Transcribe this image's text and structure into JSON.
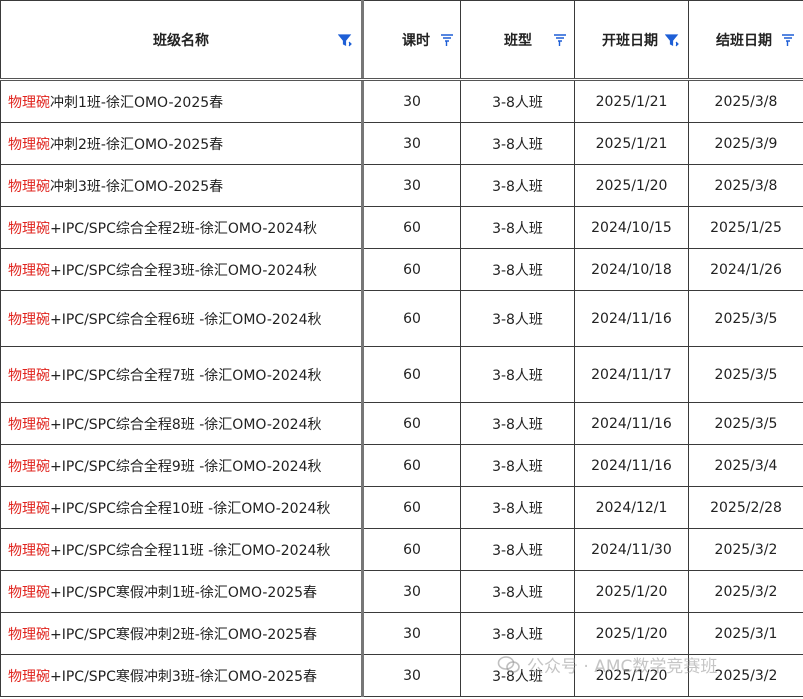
{
  "columns": [
    {
      "label": "班级名称",
      "filter": "active"
    },
    {
      "label": "课时",
      "filter": "inactive"
    },
    {
      "label": "班型",
      "filter": "inactive"
    },
    {
      "label": "开班日期",
      "filter": "active"
    },
    {
      "label": "结班日期",
      "filter": "inactive"
    }
  ],
  "rows": [
    {
      "brand": "物理碗",
      "rest": "冲刺1班-徐汇OMO-2025春",
      "hours": "30",
      "type": "3-8人班",
      "start": "2025/1/21",
      "end": "2025/3/8"
    },
    {
      "brand": "物理碗",
      "rest": "冲刺2班-徐汇OMO-2025春",
      "hours": "30",
      "type": "3-8人班",
      "start": "2025/1/21",
      "end": "2025/3/9"
    },
    {
      "brand": "物理碗",
      "rest": "冲刺3班-徐汇OMO-2025春",
      "hours": "30",
      "type": "3-8人班",
      "start": "2025/1/20",
      "end": "2025/3/8"
    },
    {
      "brand": "物理碗",
      "rest": "+IPC/SPC综合全程2班-徐汇OMO-2024秋",
      "hours": "60",
      "type": "3-8人班",
      "start": "2024/10/15",
      "end": "2025/1/25"
    },
    {
      "brand": "物理碗",
      "rest": "+IPC/SPC综合全程3班-徐汇OMO-2024秋",
      "hours": "60",
      "type": "3-8人班",
      "start": "2024/10/18",
      "end": "2024/1/26"
    },
    {
      "brand": "物理碗",
      "rest": "+IPC/SPC综合全程6班 -徐汇OMO-2024秋",
      "hours": "60",
      "type": "3-8人班",
      "start": "2024/11/16",
      "end": "2025/3/5"
    },
    {
      "brand": "物理碗",
      "rest": "+IPC/SPC综合全程7班 -徐汇OMO-2024秋",
      "hours": "60",
      "type": "3-8人班",
      "start": "2024/11/17",
      "end": "2025/3/5"
    },
    {
      "brand": "物理碗",
      "rest": "+IPC/SPC综合全程8班 -徐汇OMO-2024秋",
      "hours": "60",
      "type": "3-8人班",
      "start": "2024/11/16",
      "end": "2025/3/5"
    },
    {
      "brand": "物理碗",
      "rest": "+IPC/SPC综合全程9班 -徐汇OMO-2024秋",
      "hours": "60",
      "type": "3-8人班",
      "start": "2024/11/16",
      "end": "2025/3/4"
    },
    {
      "brand": "物理碗",
      "rest": "+IPC/SPC综合全程10班 -徐汇OMO-2024秋",
      "hours": "60",
      "type": "3-8人班",
      "start": "2024/12/1",
      "end": "2025/2/28"
    },
    {
      "brand": "物理碗",
      "rest": "+IPC/SPC综合全程11班 -徐汇OMO-2024秋",
      "hours": "60",
      "type": "3-8人班",
      "start": "2024/11/30",
      "end": "2025/3/2"
    },
    {
      "brand": "物理碗",
      "rest": "+IPC/SPC寒假冲刺1班-徐汇OMO-2025春",
      "hours": "30",
      "type": "3-8人班",
      "start": "2025/1/20",
      "end": "2025/3/2"
    },
    {
      "brand": "物理碗",
      "rest": "+IPC/SPC寒假冲刺2班-徐汇OMO-2025春",
      "hours": "30",
      "type": "3-8人班",
      "start": "2025/1/20",
      "end": "2025/3/1"
    },
    {
      "brand": "物理碗",
      "rest": "+IPC/SPC寒假冲刺3班-徐汇OMO-2025春",
      "hours": "30",
      "type": "3-8人班",
      "start": "2025/1/20",
      "end": "2025/3/2"
    }
  ],
  "watermark": "公众号 · AMC数学竞赛班",
  "colors": {
    "accent": "#1e5fd6",
    "brand_text": "#e0231d",
    "border": "#3a3a3a"
  }
}
